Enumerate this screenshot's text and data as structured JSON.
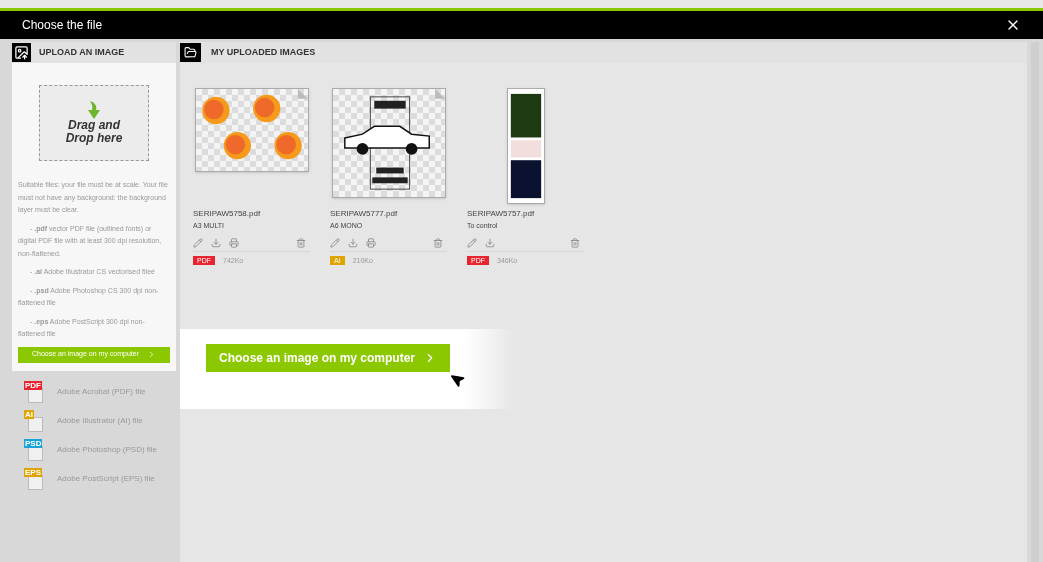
{
  "window": {
    "title": "Choose the file"
  },
  "upload_panel": {
    "title": "UPLOAD AN IMAGE",
    "dropzone": "Drag and Drop here",
    "notes": [
      "Suitable files: your file must be at scale. Your file must not have any background: the background layer must be clear.",
      "- **.pdf** vector PDF file (outlined fonts) or digital PDF file with at least 300 dpi resolution, non-flattened.",
      "- **.ai** Adobe Illustrator CS vectorised fileé",
      "- **.psd** Adobe Photoshop CS 300 dpi non-flattened file",
      "- **.eps** Adobe PostScript 300 dpi non-flattened file"
    ],
    "button": "Choose an image on my computer"
  },
  "file_types": [
    {
      "badge": "PDF",
      "color": "#e8252f",
      "label": "Adobe Acrobat (PDF) file"
    },
    {
      "badge": "AI",
      "color": "#e0a400",
      "label": "Adobe Illustrator (AI) file"
    },
    {
      "badge": "PSD",
      "color": "#1aa3d9",
      "label": "Adobe Photoshop (PSD) file"
    },
    {
      "badge": "EPS",
      "color": "#e0a400",
      "label": "Adobe PostScript (EPS) file"
    }
  ],
  "images_panel": {
    "title": "MY UPLOADED IMAGES",
    "files": [
      {
        "kind": "landscape",
        "name": "SERIPAW5758.pdf",
        "format": "A3 MULTI",
        "printable": true,
        "badge": "PDF",
        "color": "#e8252f",
        "size": "742Ko"
      },
      {
        "kind": "portrait",
        "name": "SERIPAW5777.pdf",
        "format": "A6 MONO",
        "printable": true,
        "badge": "AI",
        "color": "#e0a400",
        "size": "210Ko"
      },
      {
        "kind": "strip",
        "name": "SERIPAW5757.pdf",
        "format": "To control",
        "printable": false,
        "badge": "PDF",
        "color": "#e8252f",
        "size": "346Ko"
      }
    ]
  },
  "spotlight": {
    "button": "Choose an image on my computer"
  }
}
